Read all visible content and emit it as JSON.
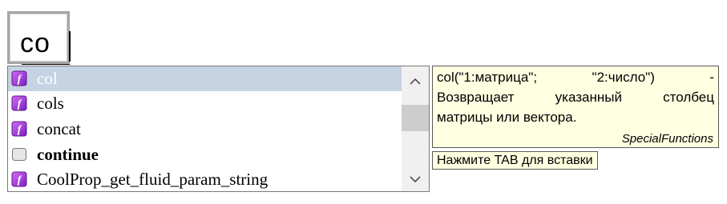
{
  "editor": {
    "typed_text": "co"
  },
  "autocomplete": {
    "items": [
      {
        "label": "col",
        "icon": "function-icon",
        "selected": true,
        "bold": false
      },
      {
        "label": "cols",
        "icon": "function-icon",
        "selected": false,
        "bold": false
      },
      {
        "label": "concat",
        "icon": "function-icon",
        "selected": false,
        "bold": false
      },
      {
        "label": "continue",
        "icon": "keyword-icon",
        "selected": false,
        "bold": true
      },
      {
        "label": "CoolProp_get_fluid_param_string",
        "icon": "function-icon",
        "selected": false,
        "bold": false
      }
    ]
  },
  "tooltip": {
    "lines": [
      "col(\"1:матрица\";  \"2:число\")  -",
      "Возвращает  указанный  столбец",
      "матрицы  или  вектора."
    ],
    "category": "SpecialFunctions"
  },
  "hint": {
    "text": "Нажмите  TAB  для  вставки"
  },
  "colors": {
    "selection": "#c5d3e2",
    "function_icon": "#9b2fd6",
    "tooltip_bg": "#ffffe1"
  }
}
